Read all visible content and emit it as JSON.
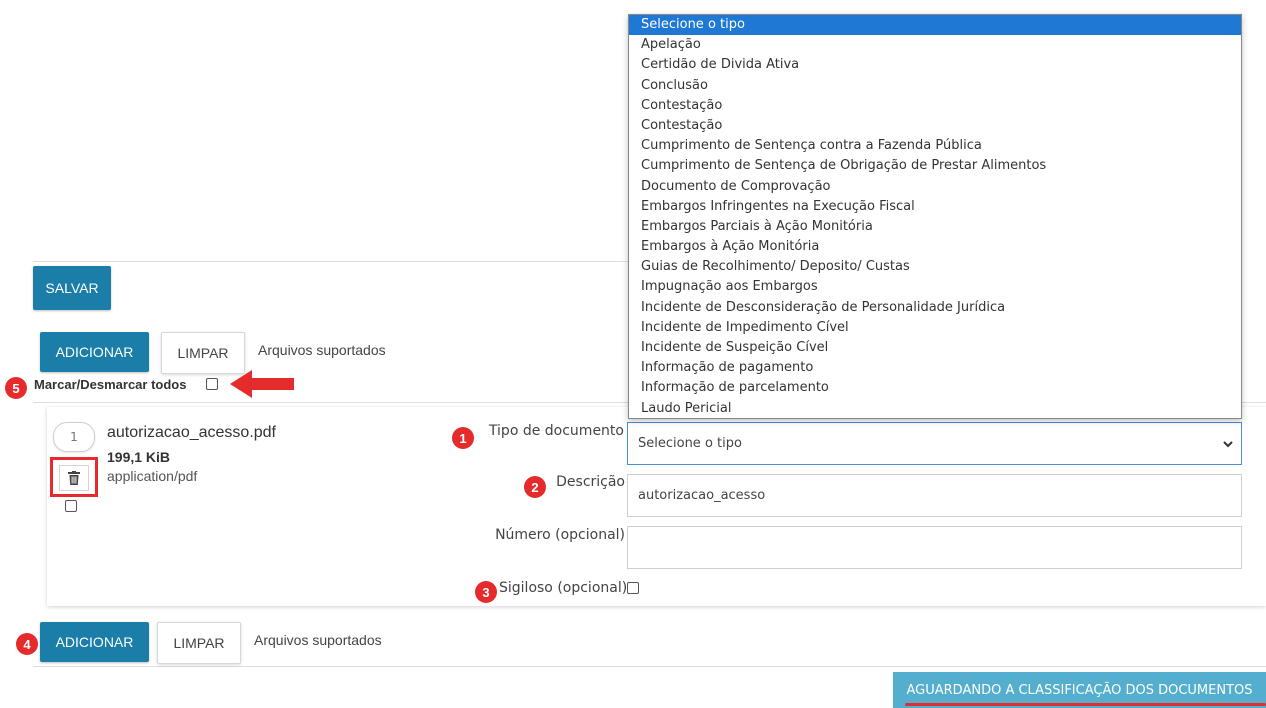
{
  "toolbar": {
    "save_label": "SALVAR",
    "add_label": "ADICIONAR",
    "clear_label": "LIMPAR",
    "supported_label": "Arquivos suportados"
  },
  "select_all_label": "Marcar/Desmarcar todos",
  "markers": [
    "1",
    "2",
    "3",
    "4",
    "5"
  ],
  "file": {
    "index": "1",
    "name": "autorizacao_acesso.pdf",
    "size": "199,1 KiB",
    "mime": "application/pdf"
  },
  "form": {
    "type_label": "Tipo de documento",
    "type_value": "Selecione o tipo",
    "description_label": "Descrição",
    "description_value": "autorizacao_acesso",
    "number_label": "Número (opcional)",
    "number_value": "",
    "secret_label": "Sigiloso (opcional)"
  },
  "dropdown": {
    "options": [
      "Selecione o tipo",
      "Apelação",
      "Certidão de Divida Ativa",
      "Conclusão",
      "Contestação",
      "Contestação",
      "Cumprimento de Sentença contra a Fazenda Pública",
      "Cumprimento de Sentença de Obrigação de Prestar Alimentos",
      "Documento de Comprovação",
      "Embargos Infringentes na Execução Fiscal",
      "Embargos Parciais à Ação Monitória",
      "Embargos à Ação Monitória",
      "Guias de Recolhimento/ Deposito/ Custas",
      "Impugnação aos Embargos",
      "Incidente de Desconsideração de Personalidade Jurídica",
      "Incidente de Impedimento Cível",
      "Incidente de Suspeição Cível",
      "Informação de pagamento",
      "Informação de parcelamento",
      "Laudo Pericial"
    ],
    "selected_index": 0
  },
  "status_button_label": "AGUARDANDO A CLASSIFICAÇÃO DOS DOCUMENTOS",
  "colors": {
    "primary": "#1a7ea8",
    "marker": "#e52b2b",
    "status_button": "#54aecd",
    "selected_option": "#1e78d4"
  },
  "icons": {
    "delete": "trash-icon",
    "pointer": "arrow-left-icon",
    "select": "chevron-down-icon"
  }
}
